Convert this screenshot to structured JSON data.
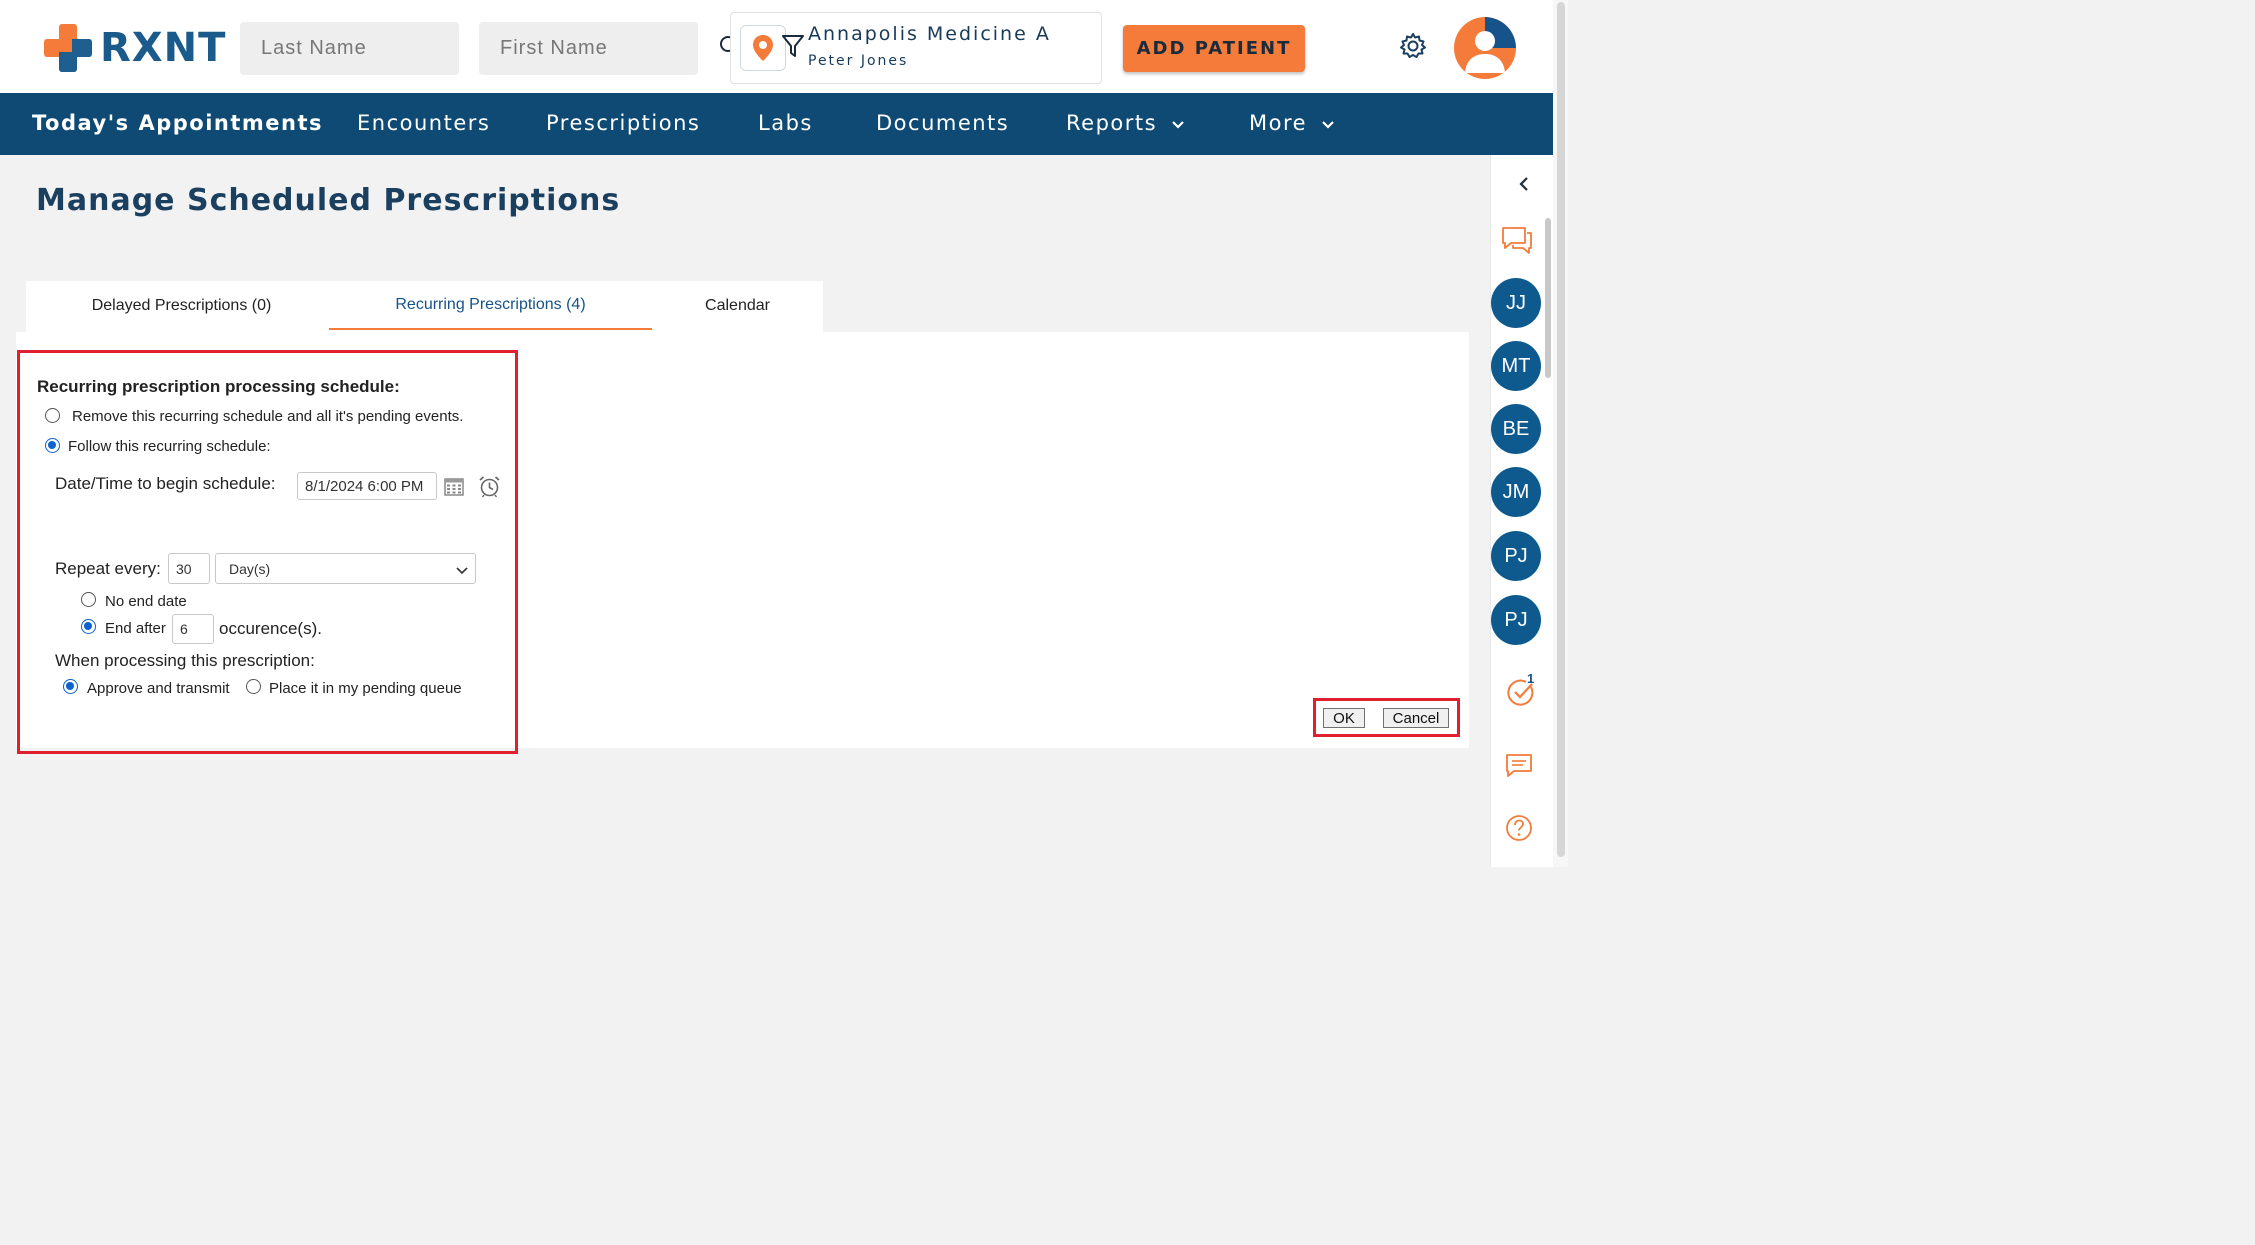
{
  "app": {
    "logo_text": "RXNT"
  },
  "header": {
    "last_name_placeholder": "Last Name",
    "first_name_placeholder": "First Name",
    "location_name": "Annapolis Medicine A",
    "location_user": "Peter Jones",
    "add_patient_label": "ADD PATIENT"
  },
  "nav": {
    "items": [
      {
        "label": "Today's Appointments"
      },
      {
        "label": "Encounters"
      },
      {
        "label": "Prescriptions"
      },
      {
        "label": "Labs"
      },
      {
        "label": "Documents"
      },
      {
        "label": "Reports"
      },
      {
        "label": "More"
      }
    ]
  },
  "page": {
    "title": "Manage Scheduled Prescriptions"
  },
  "tabs": [
    {
      "label": "Delayed Prescriptions (0)"
    },
    {
      "label": "Recurring Prescriptions (4)"
    },
    {
      "label": "Calendar"
    }
  ],
  "schedule": {
    "heading": "Recurring prescription processing schedule:",
    "remove_option": "Remove this recurring schedule and all it's pending events.",
    "follow_option": "Follow this recurring schedule:",
    "begin_label": "Date/Time to begin schedule:",
    "begin_value": "8/1/2024 6:00 PM",
    "repeat_label": "Repeat every:",
    "repeat_value": "30",
    "repeat_unit": "Day(s)",
    "no_end_label": "No end date",
    "end_after_label": "End after",
    "end_after_value": "6",
    "occurrences_label": "occurence(s).",
    "processing_label": "When processing this prescription:",
    "approve_label": "Approve and transmit",
    "pending_label": "Place it in my pending queue",
    "selected_action": "follow",
    "selected_end": "end_after",
    "selected_processing": "approve"
  },
  "buttons": {
    "ok_label": "OK",
    "cancel_label": "Cancel"
  },
  "rail": {
    "avatars": [
      "JJ",
      "MT",
      "BE",
      "JM",
      "PJ",
      "PJ"
    ],
    "task_count": "1"
  },
  "colors": {
    "brand_orange": "#f47b3a",
    "brand_navy": "#0e4a73",
    "highlight_red": "#e0202e"
  }
}
